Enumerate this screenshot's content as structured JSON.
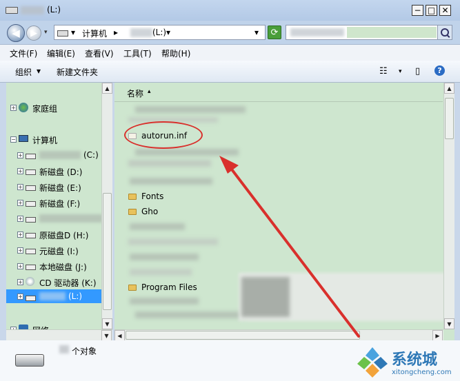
{
  "window": {
    "title_drive": "(L:)",
    "minimize": "−",
    "maximize": "□",
    "close": "✕"
  },
  "address": {
    "segments": [
      "▾",
      "计算机",
      "▸",
      "(L:)",
      "▾"
    ],
    "dropdown": "▾"
  },
  "menu": [
    "文件(F)",
    "编辑(E)",
    "查看(V)",
    "工具(T)",
    "帮助(H)"
  ],
  "toolbar": {
    "organize": "组织",
    "organize_arrow": "▾",
    "new_folder": "新建文件夹",
    "help": "?"
  },
  "nav": {
    "homegroup": "家庭组",
    "computer": "计算机",
    "drives": [
      {
        "label": "(C:)"
      },
      {
        "label": "新磁盘 (D:)"
      },
      {
        "label": "新磁盘 (E:)"
      },
      {
        "label": "新磁盘 (F:)"
      },
      {
        "label": ""
      },
      {
        "label": "原磁盘D (H:)"
      },
      {
        "label": "元磁盘 (I:)"
      },
      {
        "label": "本地磁盘 (J:)"
      },
      {
        "label": "CD 驱动器 (K:)"
      },
      {
        "label": "(L:)"
      }
    ],
    "network": "网络"
  },
  "content": {
    "column_name": "名称",
    "sort_arrow": "▴",
    "files": [
      "autorun.inf",
      "Fonts",
      "Gho",
      "Program Files"
    ]
  },
  "status": {
    "count_text": "个对象"
  },
  "watermark": {
    "brand": "系统城",
    "url": "xitongcheng.com"
  },
  "colors": {
    "pane_bg": "#cee6cf",
    "annotation": "#d9302c",
    "selection": "#3399ff"
  }
}
